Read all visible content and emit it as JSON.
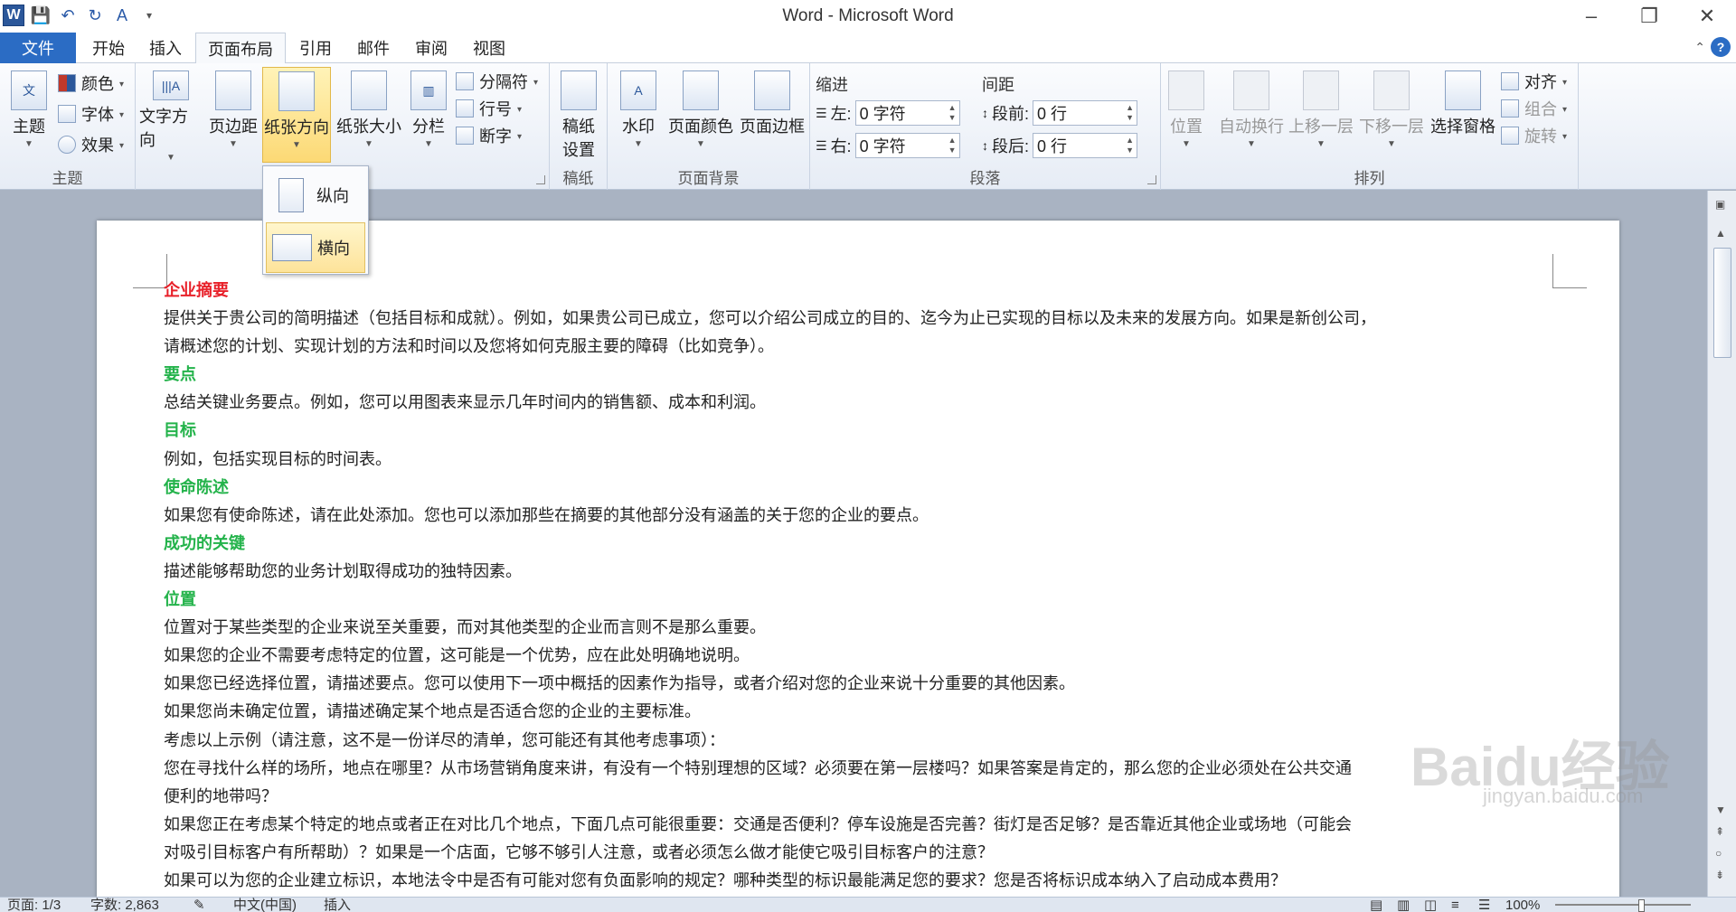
{
  "window": {
    "title": "Word - Microsoft Word"
  },
  "tabs": [
    "文件",
    "开始",
    "插入",
    "页面布局",
    "引用",
    "邮件",
    "审阅",
    "视图"
  ],
  "ribbon": {
    "theme": {
      "label": "主题",
      "theme_btn": "主题",
      "colors": "颜色",
      "fonts": "字体",
      "effects": "效果"
    },
    "page_setup": {
      "text_direction": "文字方向",
      "margins": "页边距",
      "orientation": "纸张方向",
      "size": "纸张大小",
      "columns": "分栏",
      "breaks": "分隔符",
      "line_numbers": "行号",
      "hyphenation": "断字"
    },
    "manuscript": {
      "label": "稿纸",
      "btn_line1": "稿纸",
      "btn_line2": "设置"
    },
    "page_background": {
      "label": "页面背景",
      "watermark": "水印",
      "page_color": "页面颜色",
      "page_borders": "页面边框"
    },
    "paragraph": {
      "label": "段落",
      "indent": "缩进",
      "spacing": "间距",
      "left_label": "左:",
      "left_value": "0 字符",
      "right_label": "右:",
      "right_value": "0 字符",
      "before_label": "段前:",
      "before_value": "0 行",
      "after_label": "段后:",
      "after_value": "0 行"
    },
    "arrange": {
      "label": "排列",
      "position": "位置",
      "wrap": "自动换行",
      "bring_forward": "上移一层",
      "send_backward": "下移一层",
      "selection_pane": "选择窗格",
      "align": "对齐",
      "group": "组合",
      "rotate": "旋转"
    }
  },
  "orientation_menu": {
    "portrait": "纵向",
    "landscape": "横向"
  },
  "document": {
    "lines": [
      {
        "t": "企业摘要",
        "s": "h-red"
      },
      {
        "t": "提供关于贵公司的简明描述（包括目标和成就）。例如，如果贵公司已成立，您可以介绍公司成立的目的、迄今为止已实现的目标以及未来的发展方向。如果是新创公司，",
        "s": ""
      },
      {
        "t": "请概述您的计划、实现计划的方法和时间以及您将如何克服主要的障碍（比如竞争）。",
        "s": ""
      },
      {
        "t": "要点",
        "s": "h-green"
      },
      {
        "t": "总结关键业务要点。例如，您可以用图表来显示几年时间内的销售额、成本和利润。",
        "s": ""
      },
      {
        "t": "目标",
        "s": "h-green"
      },
      {
        "t": "例如，包括实现目标的时间表。",
        "s": ""
      },
      {
        "t": "使命陈述",
        "s": "h-green"
      },
      {
        "t": "如果您有使命陈述，请在此处添加。您也可以添加那些在摘要的其他部分没有涵盖的关于您的企业的要点。",
        "s": ""
      },
      {
        "t": "成功的关键",
        "s": "h-green"
      },
      {
        "t": "描述能够帮助您的业务计划取得成功的独特因素。",
        "s": ""
      },
      {
        "t": "位置",
        "s": "h-green"
      },
      {
        "t": "位置对于某些类型的企业来说至关重要，而对其他类型的企业而言则不是那么重要。",
        "s": ""
      },
      {
        "t": "如果您的企业不需要考虑特定的位置，这可能是一个优势，应在此处明确地说明。",
        "s": ""
      },
      {
        "t": "如果您已经选择位置，请描述要点。您可以使用下一项中概括的因素作为指导，或者介绍对您的企业来说十分重要的其他因素。",
        "s": ""
      },
      {
        "t": "如果您尚未确定位置，请描述确定某个地点是否适合您的企业的主要标准。",
        "s": ""
      },
      {
        "t": "考虑以上示例（请注意，这不是一份详尽的清单，您可能还有其他考虑事项）：",
        "s": ""
      },
      {
        "t": "您在寻找什么样的场所，地点在哪里？从市场营销角度来讲，有没有一个特别理想的区域？必须要在第一层楼吗？如果答案是肯定的，那么您的企业必须处在公共交通",
        "s": ""
      },
      {
        "t": "便利的地带吗？",
        "s": ""
      },
      {
        "t": "如果您正在考虑某个特定的地点或者正在对比几个地点，下面几点可能很重要：交通是否便利？停车设施是否完善？街灯是否足够？是否靠近其他企业或场地（可能会",
        "s": ""
      },
      {
        "t": "对吸引目标客户有所帮助）？如果是一个店面，它够不够引人注意，或者必须怎么做才能使它吸引目标客户的注意？",
        "s": ""
      },
      {
        "t": "如果可以为您的企业建立标识，本地法令中是否有可能对您有负面影响的规定？哪种类型的标识最能满足您的要求？您是否将标识成本纳入了启动成本费用？",
        "s": ""
      }
    ]
  },
  "status": {
    "page": "页面: 1/3",
    "words": "字数: 2,863",
    "lang": "中文(中国)",
    "mode": "插入",
    "zoom": "100%"
  },
  "watermark": {
    "brand": "Baidu经验",
    "url": "jingyan.baidu.com"
  },
  "colors": {
    "file_tab": "#2b6cc4",
    "heading_red": "#e8212a",
    "heading_green": "#24b34b"
  }
}
